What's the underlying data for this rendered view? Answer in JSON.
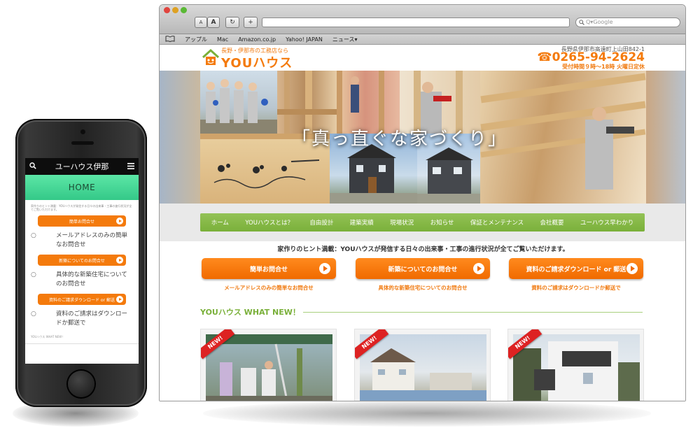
{
  "mobile": {
    "nav_title": "ユーハウス伊那",
    "search_icon": "search-icon",
    "menu_icon": "hamburger-icon",
    "hero_title": "HOME",
    "tiny_text": "家作りのヒント満載：YOUハウスが発信する日々の出来事・工事の進行状況が全てご覧いただけます。",
    "items": [
      {
        "button": "簡単お問合せ",
        "desc": "メールアドレスのみの簡単なお問合せ"
      },
      {
        "button": "新築についてのお問合せ",
        "desc": "具体的な新築住宅についてのお問合せ"
      },
      {
        "button": "資料のご請求ダウンロード or 郵送",
        "desc": "資料のご請求はダウンロードか郵送で"
      }
    ],
    "bullet": "○",
    "footer_tiny": "YOUハウス WHAT NEW！"
  },
  "browser": {
    "bookmarks": [
      "アップル",
      "Mac",
      "Amazon.co.jp",
      "Yahoo! JAPAN",
      "ニュース▾"
    ],
    "search_placeholder": "Q▾Google",
    "buttons": {
      "font_small": "A",
      "font_large": "A",
      "reload": "↻",
      "add": "+"
    }
  },
  "site": {
    "logo_tagline": "長野・伊那市の工務店なら",
    "logo_name": "YOUハウス",
    "address": "長野県伊那市高遠町上山田842-1",
    "phone": "☎0265-94-2624",
    "hours": "受付時間９時～18時 火曜日定休",
    "hero_text": "「真っ直ぐな家づくり」",
    "nav": [
      "ホーム",
      "YOUハウスとは？",
      "自由設計",
      "建築実績",
      "現場状況",
      "お知らせ",
      "保証とメンテナンス",
      "会社概要",
      "ユーハウス早わかり"
    ],
    "tagline": "家作りのヒント満載：YOUハウスが発信する日々の出来事・工事の進行状況が全てご覧いただけます。",
    "cta": [
      {
        "label": "簡単お問合せ",
        "sub": "メールアドレスのみの簡単なお問合せ"
      },
      {
        "label": "新築についてのお問合せ",
        "sub": "具体的な新築住宅についてのお問合せ"
      },
      {
        "label": "資料のご請求ダウンロード or 郵送",
        "sub": "資料のご請求はダウンロードか郵送で"
      }
    ],
    "whatnew_title": "YOUハウス WHAT NEW！",
    "ribbon": "NEW!"
  },
  "colors": {
    "orange": "#f47a0c",
    "green": "#7ab03a",
    "mint": "#4fdc9c"
  }
}
